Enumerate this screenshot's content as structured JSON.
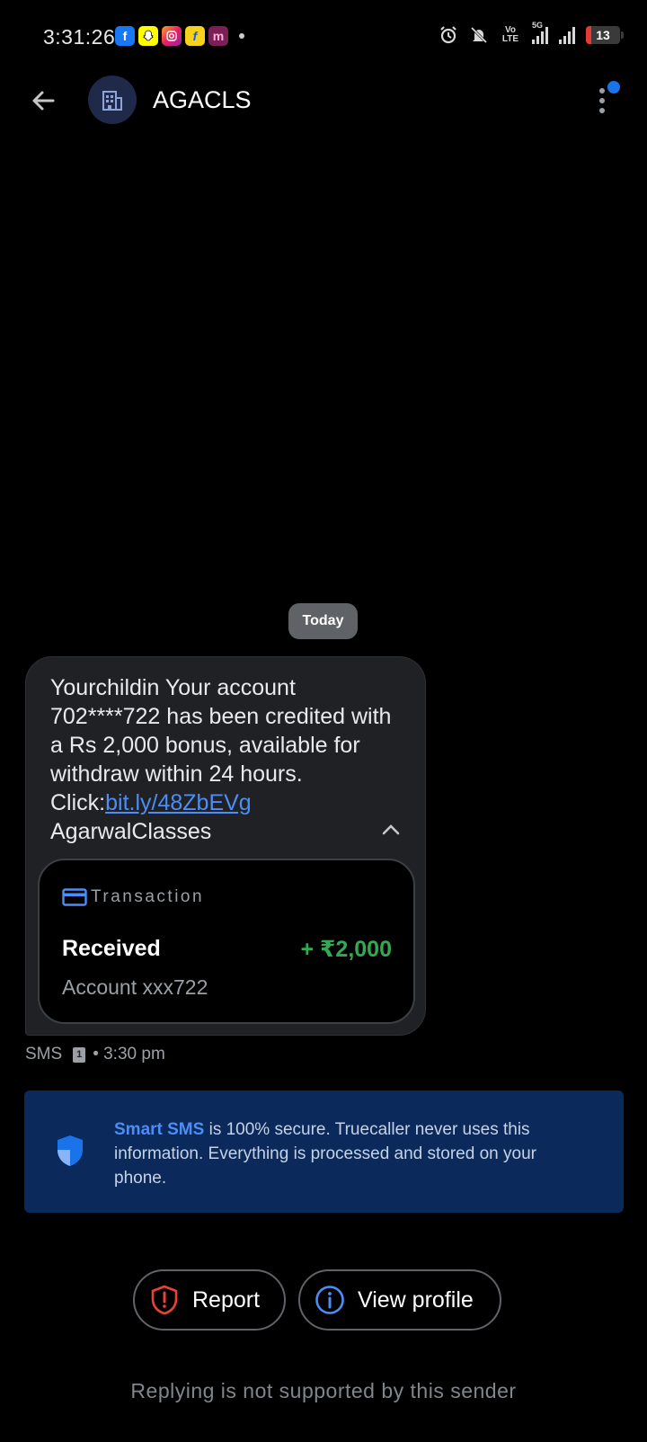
{
  "status_bar": {
    "time": "3:31:26",
    "battery": "13",
    "network_label": "Vo LTE",
    "network_type": "5G",
    "notification_icons": [
      "facebook-icon",
      "snapchat-icon",
      "instagram-icon",
      "flipkart-icon",
      "meesho-icon"
    ]
  },
  "header": {
    "sender_name": "AGACLS",
    "avatar_icon": "building-icon"
  },
  "conversation": {
    "date_chip": "Today",
    "message": {
      "text": "Yourchildin Your account 702****722 has been credited with a Rs 2,000 bonus, available for withdraw within 24 hours. Click:",
      "link": "bit.ly/48ZbEVg",
      "signature": "AgarwalClasses",
      "transaction": {
        "label": "Transaction",
        "status": "Received",
        "amount": "+ ₹2,000",
        "account": "Account xxx722"
      },
      "channel": "SMS",
      "sim": "1",
      "time": "• 3:30 pm"
    }
  },
  "info_banner": {
    "highlight": "Smart SMS",
    "text": " is 100% secure. Truecaller never uses this information. Everything is processed and stored on your phone."
  },
  "actions": {
    "report_label": "Report",
    "view_profile_label": "View profile"
  },
  "footer": {
    "text": "Replying is not supported by this sender"
  },
  "colors": {
    "accent": "#1a73e8",
    "link": "#4c8df6",
    "amount_green": "#34a853",
    "report_red": "#ea4335",
    "banner_bg": "#0b2a5b"
  }
}
